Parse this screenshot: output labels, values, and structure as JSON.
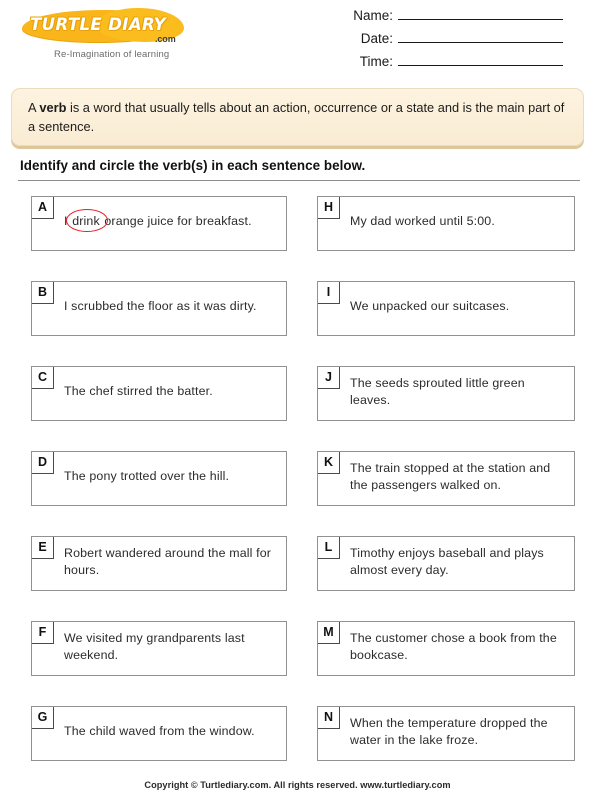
{
  "brand": {
    "logo_line": "TURTLE DIARY",
    "logo_suffix": ".com",
    "tagline": "Re-Imagination of learning",
    "logo_color": "#f9b519"
  },
  "header_fields": [
    {
      "label": "Name:",
      "value": ""
    },
    {
      "label": "Date:",
      "value": ""
    },
    {
      "label": "Time:",
      "value": ""
    }
  ],
  "definition": {
    "lead": "A ",
    "term": "verb",
    "rest": " is a word that usually tells about an action, occurrence or a state and is the main part of a sentence."
  },
  "instruction": "Identify and circle the verb(s) in each sentence below.",
  "annotation_color": "#ec1c24",
  "questions_left": [
    {
      "letter": "A",
      "pre": "I ",
      "circled": "drink",
      "post": " orange juice for breakfast.",
      "lines": 1
    },
    {
      "letter": "B",
      "pre": "I scrubbed the floor as it was dirty.",
      "circled": "",
      "post": "",
      "lines": 1
    },
    {
      "letter": "C",
      "pre": "The chef stirred the batter.",
      "circled": "",
      "post": "",
      "lines": 1
    },
    {
      "letter": "D",
      "pre": "The pony trotted over the hill.",
      "circled": "",
      "post": "",
      "lines": 1
    },
    {
      "letter": "E",
      "pre": "Robert wandered around the mall for hours.",
      "circled": "",
      "post": "",
      "lines": 2
    },
    {
      "letter": "F",
      "pre": "We visited my grandparents last weekend.",
      "circled": "",
      "post": "",
      "lines": 2
    },
    {
      "letter": "G",
      "pre": "The child waved from the window.",
      "circled": "",
      "post": "",
      "lines": 1
    }
  ],
  "questions_right": [
    {
      "letter": "H",
      "pre": "My dad worked until 5:00.",
      "circled": "",
      "post": "",
      "lines": 1
    },
    {
      "letter": "I",
      "pre": "We unpacked our suitcases.",
      "circled": "",
      "post": "",
      "lines": 1
    },
    {
      "letter": "J",
      "pre": "The seeds sprouted little green leaves.",
      "circled": "",
      "post": "",
      "lines": 2
    },
    {
      "letter": "K",
      "pre": "The train stopped at the station and the passengers walked on.",
      "circled": "",
      "post": "",
      "lines": 2
    },
    {
      "letter": "L",
      "pre": "Timothy enjoys baseball and plays almost every day.",
      "circled": "",
      "post": "",
      "lines": 2
    },
    {
      "letter": "M",
      "pre": "The customer chose a book from the bookcase.",
      "circled": "",
      "post": "",
      "lines": 2
    },
    {
      "letter": "N",
      "pre": "When the temperature dropped the water in the lake froze.",
      "circled": "",
      "post": "",
      "lines": 2
    }
  ],
  "footer": "Copyright © Turtlediary.com. All rights reserved. www.turtlediary.com"
}
